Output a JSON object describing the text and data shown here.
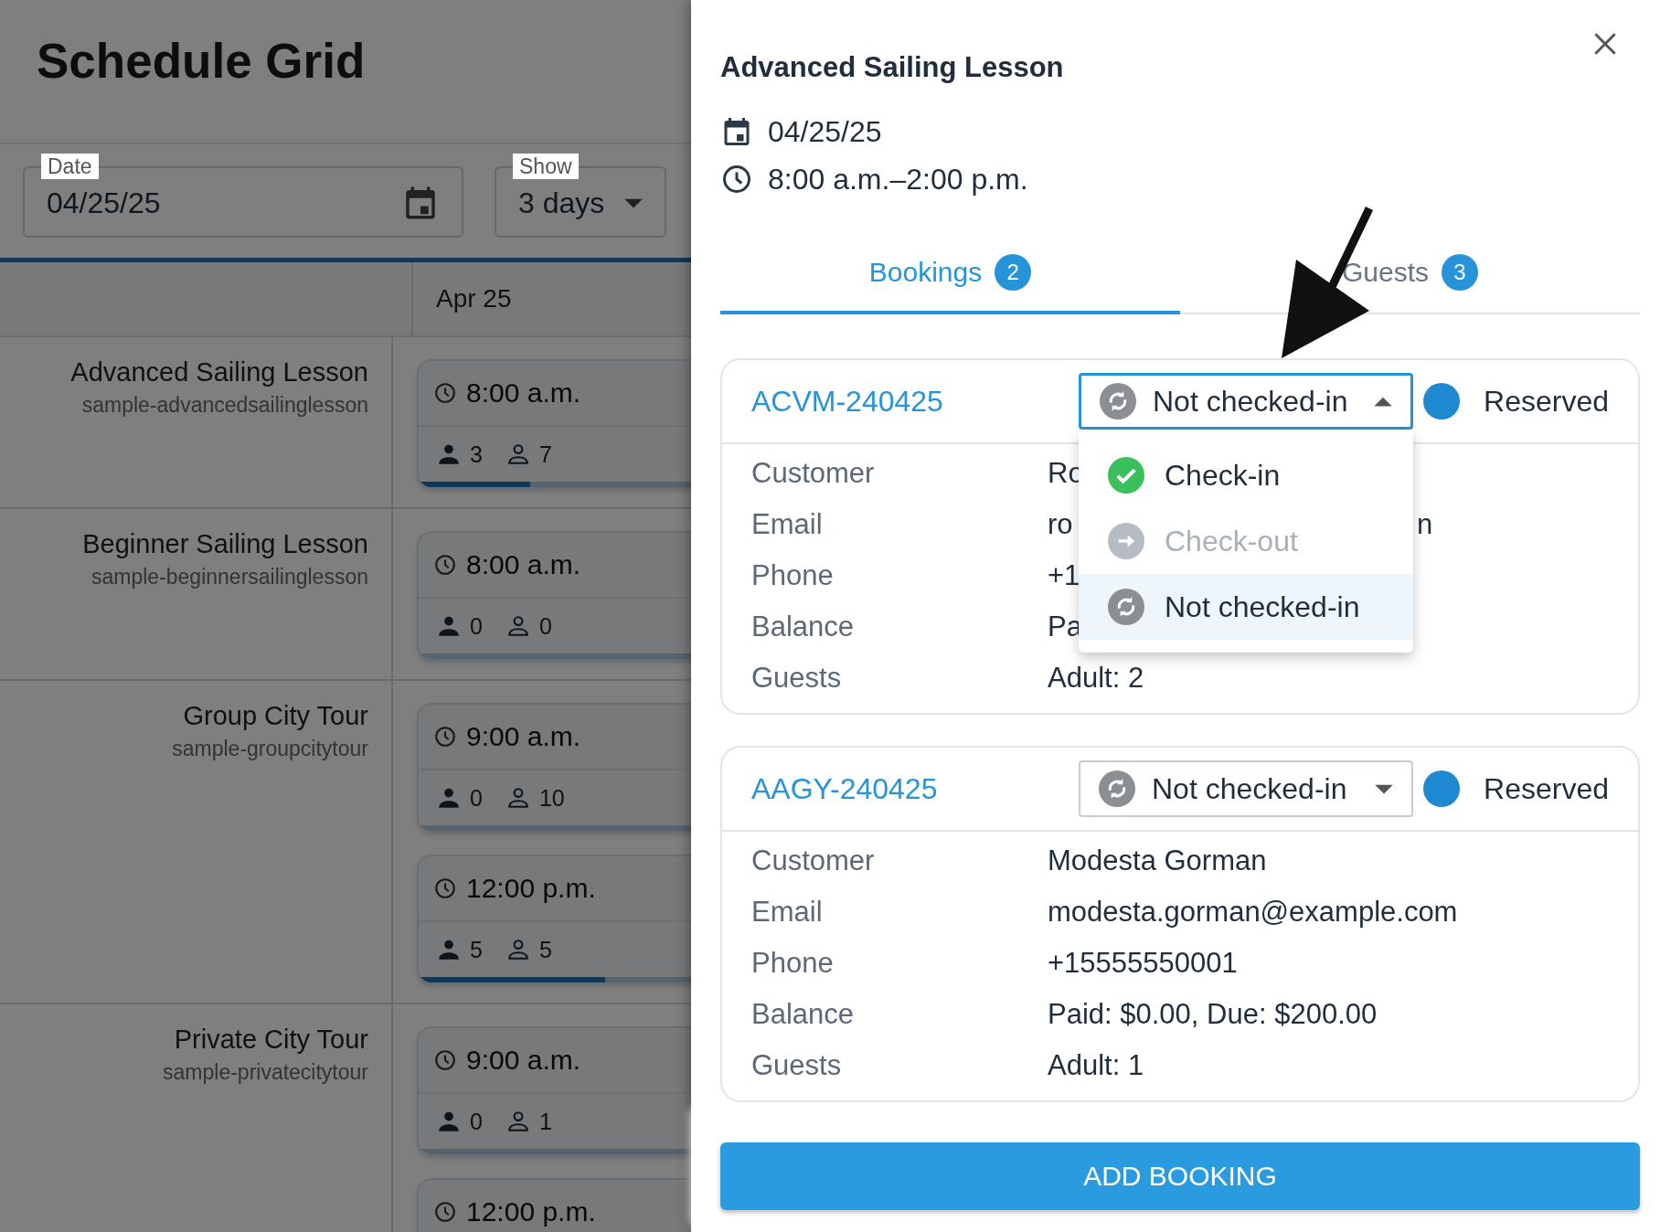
{
  "page": {
    "title": "Schedule Grid",
    "date_field": {
      "label": "Date",
      "value": "04/25/25"
    },
    "show_field": {
      "label": "Show",
      "value": "3 days"
    },
    "grid": {
      "columns": [
        {
          "label": "Apr 25"
        }
      ],
      "rows": [
        {
          "name": "Advanced Sailing Lesson",
          "slug": "sample-advancedsailinglesson",
          "events": [
            {
              "time": "8:00 a.m.",
              "booked": "3",
              "available": "7",
              "level": 0.3
            }
          ]
        },
        {
          "name": "Beginner Sailing Lesson",
          "slug": "sample-beginnersailinglesson",
          "events": [
            {
              "time": "8:00 a.m.",
              "booked": "0",
              "available": "0",
              "level": 0
            }
          ]
        },
        {
          "name": "Group City Tour",
          "slug": "sample-groupcitytour",
          "events": [
            {
              "time": "9:00 a.m.",
              "booked": "0",
              "available": "10",
              "level": 0
            },
            {
              "time": "12:00 p.m.",
              "booked": "5",
              "available": "5",
              "level": 0.5
            }
          ]
        },
        {
          "name": "Private City Tour",
          "slug": "sample-privatecitytour",
          "events": [
            {
              "time": "9:00 a.m.",
              "booked": "0",
              "available": "1",
              "level": 0
            },
            {
              "time": "12:00 p.m."
            }
          ]
        }
      ]
    }
  },
  "drawer": {
    "title": "Advanced Sailing Lesson",
    "date": "04/25/25",
    "time": "8:00 a.m.–2:00 p.m.",
    "tabs": [
      {
        "label": "Bookings",
        "count": "2",
        "selected": true
      },
      {
        "label": "Guests",
        "count": "3",
        "selected": false
      }
    ],
    "bookings": [
      {
        "code": "ACVM-240425",
        "check_status": "Not checked-in",
        "expanded": true,
        "status": {
          "label": "Reserved",
          "color": "#1e88d0"
        },
        "options": [
          {
            "kind": "check-in",
            "label": "Check-in",
            "disabled": false,
            "selected": false
          },
          {
            "kind": "check-out",
            "label": "Check-out",
            "disabled": true,
            "selected": false
          },
          {
            "kind": "not-checked-in",
            "label": "Not checked-in",
            "disabled": false,
            "selected": true
          }
        ],
        "fields": [
          {
            "label": "Customer",
            "value": "Ro"
          },
          {
            "label": "Email",
            "value": "ro",
            "tail": "n"
          },
          {
            "label": "Phone",
            "value": "+1"
          },
          {
            "label": "Balance",
            "value": "Pa"
          },
          {
            "label": "Guests",
            "value": "Adult: 2"
          }
        ]
      },
      {
        "code": "AAGY-240425",
        "check_status": "Not checked-in",
        "expanded": false,
        "status": {
          "label": "Reserved",
          "color": "#1e88d0"
        },
        "fields": [
          {
            "label": "Customer",
            "value": "Modesta Gorman"
          },
          {
            "label": "Email",
            "value": "modesta.gorman@example.com"
          },
          {
            "label": "Phone",
            "value": "+15555550001"
          },
          {
            "label": "Balance",
            "value": "Paid: $0.00, Due: $200.00"
          },
          {
            "label": "Guests",
            "value": "Adult: 1"
          }
        ]
      }
    ],
    "action": "ADD BOOKING"
  }
}
